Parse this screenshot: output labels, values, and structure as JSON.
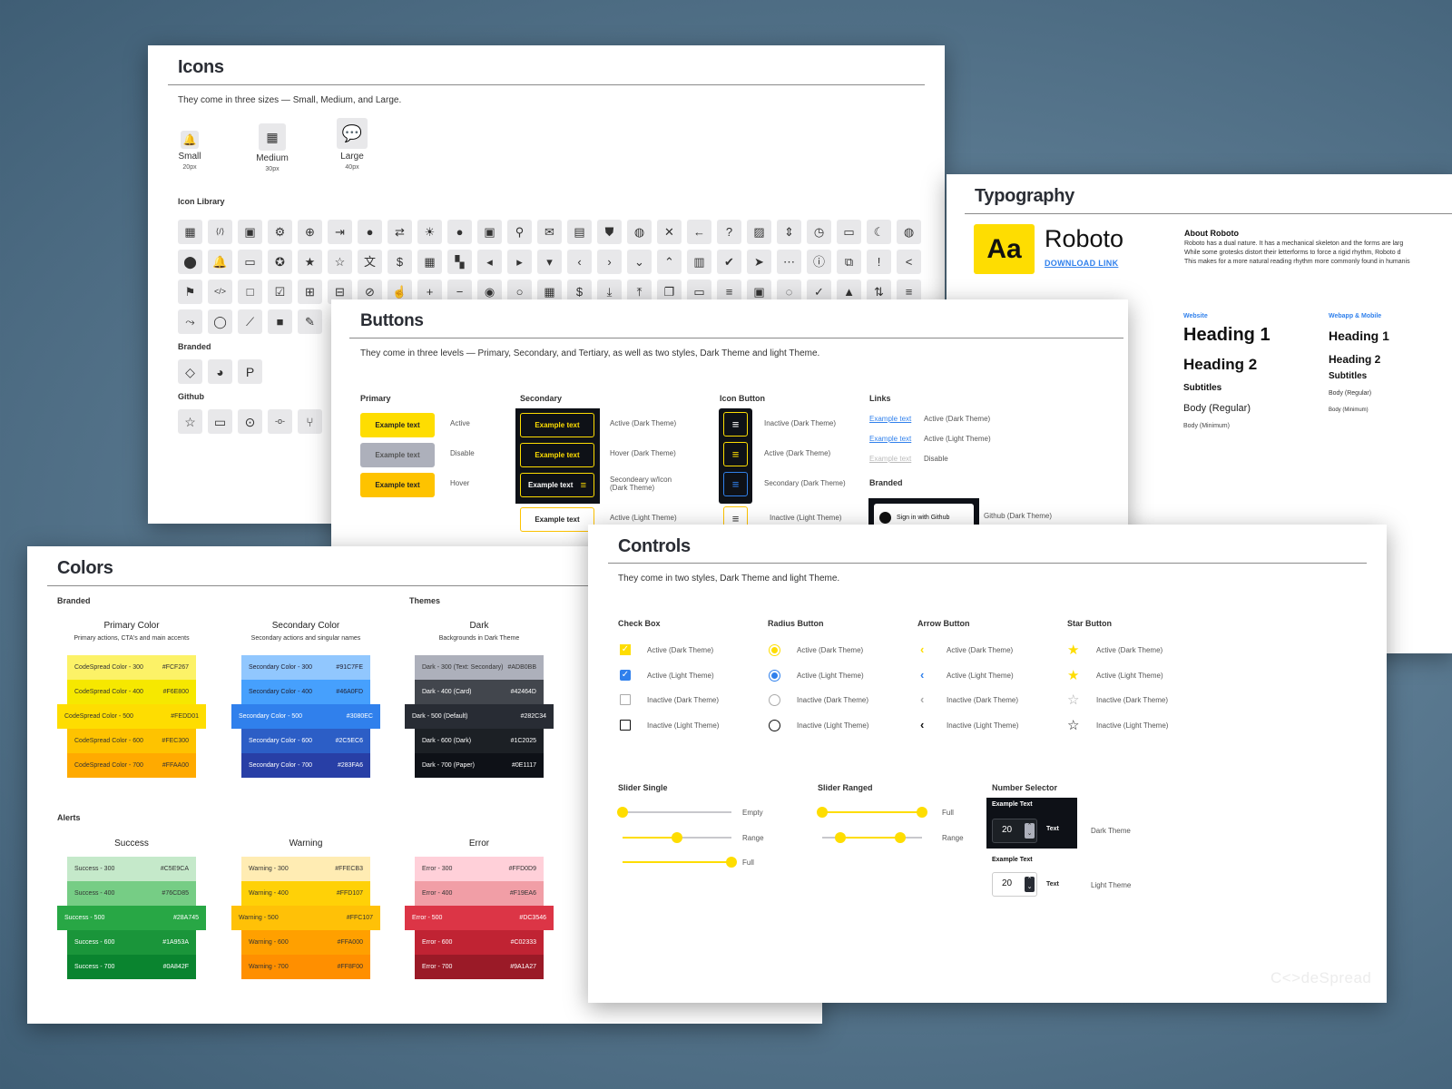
{
  "icons_sheet": {
    "title": "Icons",
    "description": "They come in three sizes — Small, Medium, and Large.",
    "sizes": [
      {
        "label": "Small",
        "px": "20px",
        "icon": "bell-icon",
        "glyph": "🔔"
      },
      {
        "label": "Medium",
        "px": "30px",
        "icon": "calendar-icon",
        "glyph": "▦"
      },
      {
        "label": "Large",
        "px": "40px",
        "icon": "chat-bubble-icon",
        "glyph": "💬"
      }
    ],
    "library_label": "Icon Library",
    "library": [
      [
        "dashboard-icon",
        "code-file-icon",
        "contact-card-icon",
        "gear-icon",
        "lifebuoy-icon",
        "logout-icon",
        "account-icon",
        "swap-icon",
        "brightness-icon",
        "chat-icon",
        "badge-icon",
        "search-icon",
        "mail-icon",
        "invoice-icon",
        "shield-check-icon",
        "money-bag-icon",
        "close-icon",
        "arrow-left-icon",
        "help-icon",
        "image-icon",
        "unfold-icon",
        "clock-icon",
        "folder-icon",
        "moon-icon",
        "globe-icon"
      ],
      [
        "location-pin-icon",
        "bell-icon",
        "laptop-icon",
        "verified-icon",
        "star-filled-icon",
        "star-outline-icon",
        "translate-icon",
        "dollar-circle-icon",
        "event-icon",
        "hierarchy-icon",
        "caret-left-icon",
        "caret-right-icon",
        "caret-down-icon",
        "chevron-left-icon",
        "chevron-right-icon",
        "chevron-down-icon",
        "chevron-up-icon",
        "delete-icon",
        "check-circle-icon",
        "send-icon",
        "more-horizontal-icon",
        "info-icon",
        "open-external-icon",
        "alert-circle-icon",
        "share-icon"
      ],
      [
        "flag-icon",
        "code-icon",
        "checkbox-empty-icon",
        "checkbox-checked-icon",
        "plus-box-icon",
        "minus-box-icon",
        "attachment-icon",
        "touch-icon",
        "plus-icon",
        "minus-icon",
        "radio-checked-icon",
        "radio-empty-icon",
        "calendar-icon",
        "dollar-icon",
        "download-icon",
        "upload-icon",
        "copy-icon",
        "credit-card-icon",
        "menu-icon",
        "atm-icon",
        "timer-dashed-icon",
        "check-outline-icon",
        "warning-icon",
        "sort-icon",
        "filter-icon"
      ],
      [
        "analytics-search-icon",
        "loading-ring-icon",
        "line-chart-icon",
        "video-icon",
        "pencil-icon"
      ]
    ],
    "library_glyphs": [
      [
        "▦",
        "⟨/⟩",
        "▣",
        "⚙",
        "⊕",
        "⇥",
        "●",
        "⇄",
        "☀",
        "●",
        "▣",
        "⚲",
        "✉",
        "▤",
        "⛊",
        "◍",
        "✕",
        "←",
        "?",
        "▨",
        "⇕",
        "◷",
        "▭",
        "☾",
        "◍"
      ],
      [
        "⬤",
        "🔔",
        "▭",
        "✪",
        "★",
        "☆",
        "文",
        "$",
        "▦",
        "▚",
        "◂",
        "▸",
        "▾",
        "‹",
        "›",
        "⌄",
        "⌃",
        "▥",
        "✔",
        "➤",
        "⋯",
        "ⓘ",
        "⧉",
        "!",
        "<"
      ],
      [
        "⚑",
        "</>",
        "□",
        "☑",
        "⊞",
        "⊟",
        "⊘",
        "☝",
        "+",
        "−",
        "◉",
        "○",
        "▦",
        "$",
        "⤓",
        "⤒",
        "❐",
        "▭",
        "≡",
        "▣",
        "◌",
        "✓",
        "▲",
        "⇅",
        "≡"
      ],
      [
        "⤳",
        "◯",
        "⟋",
        "■",
        "✎"
      ]
    ],
    "branded_label": "Branded",
    "branded": [
      {
        "icon": "codespread-logo-icon",
        "glyph": "◇"
      },
      {
        "icon": "github-icon",
        "glyph": "◕"
      },
      {
        "icon": "paypal-icon",
        "glyph": "P"
      }
    ],
    "github_label": "Github",
    "github": [
      {
        "icon": "star-outline-icon",
        "glyph": "☆"
      },
      {
        "icon": "repo-icon",
        "glyph": "▭"
      },
      {
        "icon": "issue-icon",
        "glyph": "⊙"
      },
      {
        "icon": "commit-icon",
        "glyph": "-o-"
      },
      {
        "icon": "branch-icon",
        "glyph": "⑂"
      }
    ]
  },
  "typography_sheet": {
    "title": "Typography",
    "font_sample": "Aa",
    "font_name": "Roboto",
    "download_link": "DOWNLOAD LINK",
    "about_title": "About Roboto",
    "about_lines": [
      "Roboto has a dual nature. It has a mechanical skeleton and the forms are larg",
      "While some grotesks distort their letterforms to force a rigid rhythm, Roboto d",
      "This makes for a more natural reading rhythm more commonly found in humanis"
    ],
    "website": {
      "label": "Website",
      "h1": "Heading 1",
      "h2": "Heading 2",
      "subtitles": "Subtitles",
      "body_regular": "Body (Regular)",
      "body_minimum": "Body (Minimum)"
    },
    "webapp": {
      "label": "Webapp & Mobile",
      "h1": "Heading 1",
      "h2": "Heading 2",
      "subtitles": "Subtitles",
      "body_regular": "Body (Regular)",
      "body_minimum": "Body (Minimum)"
    }
  },
  "buttons_sheet": {
    "title": "Buttons",
    "description": "They come in three levels — Primary, Secondary, and Tertiary, as well as two styles, Dark Theme and light Theme.",
    "primary": {
      "label": "Primary",
      "items": [
        {
          "text": "Example text",
          "state": "Active",
          "color": "#FEDD01"
        },
        {
          "text": "Example text",
          "state": "Disable",
          "color": "#ADB0BB"
        },
        {
          "text": "Example text",
          "state": "Hover",
          "color": "#FEC300"
        }
      ]
    },
    "secondary": {
      "label": "Secondary",
      "items": [
        {
          "text": "Example text",
          "state": "Active (Dark Theme)"
        },
        {
          "text": "Example text",
          "state": "Hover (Dark Theme)"
        },
        {
          "text": "Example text",
          "state": "Secondeary w/Icon (Dark Theme)"
        },
        {
          "text": "Example text",
          "state": "Active (Light Theme)"
        }
      ]
    },
    "icon_button": {
      "label": "Icon Button",
      "items": [
        {
          "state": "Inactive (Dark Theme)"
        },
        {
          "state": "Active (Dark Theme)"
        },
        {
          "state": "Secondary (Dark Theme)"
        },
        {
          "state": "Inactive (Light Theme)"
        }
      ]
    },
    "links": {
      "label": "Links",
      "items": [
        {
          "text": "Example text",
          "state": "Active (Dark Theme)"
        },
        {
          "text": "Example text",
          "state": "Active (Light Theme)"
        },
        {
          "text": "Example text",
          "state": "Disable"
        }
      ]
    },
    "branded": {
      "label": "Branded",
      "github_button": "Sign in with Github",
      "github_state": "Github (Dark Theme)"
    }
  },
  "colors_sheet": {
    "title": "Colors",
    "branded_label": "Branded",
    "themes_label": "Themes",
    "alerts_label": "Alerts",
    "palettes": [
      {
        "title": "Primary Color",
        "subtitle": "Primary actions, CTA's and main accents",
        "swatches": [
          {
            "name": "CodeSpread Color - 300",
            "hex": "#FCF267",
            "text": "#333"
          },
          {
            "name": "CodeSpread Color - 400",
            "hex": "#F6E800",
            "text": "#333"
          },
          {
            "name": "CodeSpread Color - 500",
            "hex": "#FEDD01",
            "text": "#333"
          },
          {
            "name": "CodeSpread Color - 600",
            "hex": "#FEC300",
            "text": "#333"
          },
          {
            "name": "CodeSpread Color - 700",
            "hex": "#FFAA00",
            "text": "#333"
          }
        ]
      },
      {
        "title": "Secondary Color",
        "subtitle": "Secondary actions and singular names",
        "swatches": [
          {
            "name": "Secondary Color - 300",
            "hex": "#91C7FE",
            "text": "#223"
          },
          {
            "name": "Secondary Color - 400",
            "hex": "#46A0FD",
            "text": "#223"
          },
          {
            "name": "Secondary Color - 500",
            "hex": "#3080EC",
            "text": "#fff"
          },
          {
            "name": "Secondary Color - 600",
            "hex": "#2C5EC6",
            "text": "#fff"
          },
          {
            "name": "Secondary Color - 700",
            "hex": "#283FA6",
            "text": "#fff"
          }
        ]
      },
      {
        "title": "Dark",
        "subtitle": "Backgrounds in Dark Theme",
        "swatches": [
          {
            "name": "Dark - 300 (Text: Secondary)",
            "hex": "#ADB0BB",
            "text": "#333"
          },
          {
            "name": "Dark - 400 (Card)",
            "hex": "#42464D",
            "text": "#fff"
          },
          {
            "name": "Dark - 500 (Default)",
            "hex": "#282C34",
            "text": "#fff"
          },
          {
            "name": "Dark - 600 (Dark)",
            "hex": "#1C2025",
            "text": "#fff"
          },
          {
            "name": "Dark - 700 (Paper)",
            "hex": "#0E1117",
            "text": "#fff"
          }
        ]
      },
      {
        "title": "Success",
        "subtitle": "",
        "swatches": [
          {
            "name": "Success - 300",
            "hex": "#C5E9CA",
            "text": "#333"
          },
          {
            "name": "Success - 400",
            "hex": "#76CD85",
            "text": "#333"
          },
          {
            "name": "Success - 500",
            "hex": "#28A745",
            "text": "#fff"
          },
          {
            "name": "Success - 600",
            "hex": "#1A953A",
            "text": "#fff"
          },
          {
            "name": "Success - 700",
            "hex": "#0A842F",
            "text": "#fff"
          }
        ]
      },
      {
        "title": "Warning",
        "subtitle": "",
        "swatches": [
          {
            "name": "Warning - 300",
            "hex": "#FFECB3",
            "text": "#333"
          },
          {
            "name": "Warning - 400",
            "hex": "#FFD107",
            "text": "#333"
          },
          {
            "name": "Warning - 500",
            "hex": "#FFC107",
            "text": "#333"
          },
          {
            "name": "Warning - 600",
            "hex": "#FFA000",
            "text": "#333"
          },
          {
            "name": "Warning - 700",
            "hex": "#FF8F00",
            "text": "#333"
          }
        ]
      },
      {
        "title": "Error",
        "subtitle": "",
        "swatches": [
          {
            "name": "Error - 300",
            "hex": "#FFD0D9",
            "text": "#333"
          },
          {
            "name": "Error - 400",
            "hex": "#F19EA6",
            "text": "#333"
          },
          {
            "name": "Error - 500",
            "hex": "#DC3546",
            "text": "#fff"
          },
          {
            "name": "Error - 600",
            "hex": "#C02333",
            "text": "#fff"
          },
          {
            "name": "Error - 700",
            "hex": "#9A1A27",
            "text": "#fff"
          }
        ]
      }
    ]
  },
  "controls_sheet": {
    "title": "Controls",
    "description": "They come in two styles, Dark Theme and light Theme.",
    "checkbox": {
      "label": "Check Box",
      "items": [
        "Active (Dark Theme)",
        "Active (Light Theme)",
        "Inactive (Dark Theme)",
        "Inactive (Light Theme)"
      ]
    },
    "radio": {
      "label": "Radius Button",
      "items": [
        "Active (Dark Theme)",
        "Active (Light Theme)",
        "Inactive (Dark Theme)",
        "Inactive (Light Theme)"
      ]
    },
    "arrow": {
      "label": "Arrow Button",
      "items": [
        "Active (Dark Theme)",
        "Active (Light Theme)",
        "Inactive (Dark Theme)",
        "Inactive (Light Theme)"
      ]
    },
    "star": {
      "label": "Star Button",
      "items": [
        "Active (Dark Theme)",
        "Active (Light Theme)",
        "Inactive (Dark Theme)",
        "Inactive (Light Theme)"
      ]
    },
    "slider_single": {
      "label": "Slider Single",
      "items": [
        {
          "state": "Empty",
          "value": 0
        },
        {
          "state": "Range",
          "value": 0.5
        },
        {
          "state": "Full",
          "value": 1
        }
      ]
    },
    "slider_ranged": {
      "label": "Slider Ranged",
      "items": [
        {
          "state": "Full",
          "low": 0,
          "high": 1
        },
        {
          "state": "Range",
          "low": 0.18,
          "high": 0.78
        }
      ]
    },
    "number_selector": {
      "label": "Number Selector",
      "dark": {
        "field_label": "Example Text",
        "value": "20",
        "unit": "Text",
        "theme": "Dark Theme"
      },
      "light": {
        "field_label": "Example Text",
        "value": "20",
        "unit": "Text",
        "theme": "Light Theme"
      }
    },
    "watermark": "C<>deSpread"
  },
  "colors": {
    "yellow": "#FEDD01",
    "blue": "#3080EC",
    "dark": "#0E1117"
  }
}
